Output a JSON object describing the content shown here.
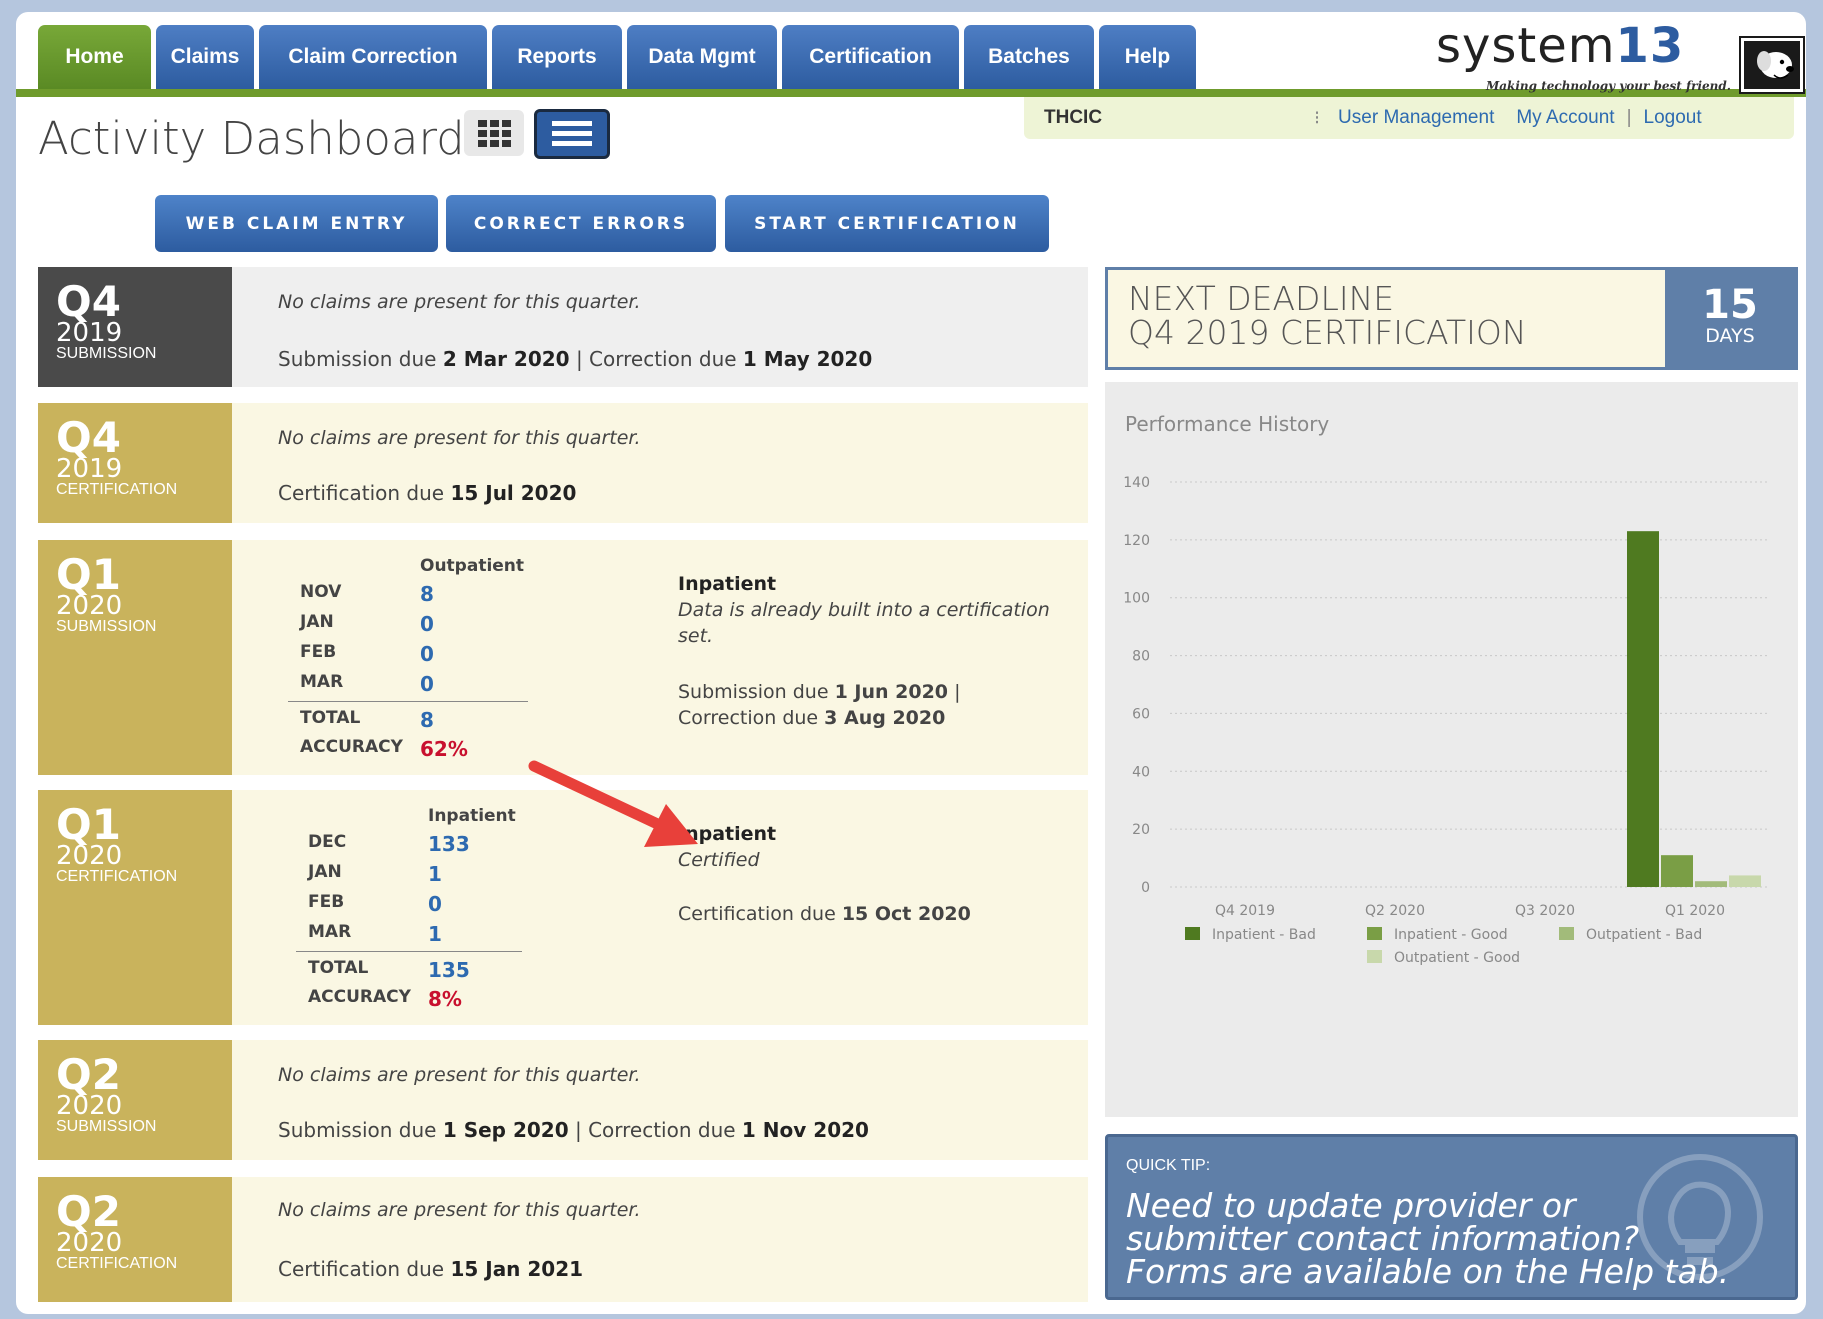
{
  "nav": {
    "tabs": [
      "Home",
      "Claims",
      "Claim Correction",
      "Reports",
      "Data Mgmt",
      "Certification",
      "Batches",
      "Help"
    ],
    "active_tab": "Home"
  },
  "logo": {
    "name_part1": "system",
    "name_part2": "13",
    "tagline": "Making technology your best friend."
  },
  "account": {
    "org": "THCIC",
    "links": {
      "user_management": "User Management",
      "my_account": "My Account",
      "logout": "Logout"
    }
  },
  "header": {
    "title": "Activity Dashboard"
  },
  "actions": {
    "web_claim_entry": "WEB CLAIM ENTRY",
    "correct_errors": "CORRECT ERRORS",
    "start_certification": "START CERTIFICATION"
  },
  "quarters": [
    {
      "q": "Q4",
      "year": "2019",
      "kind": "SUBMISSION",
      "note": "No claims are present for this quarter.",
      "due_parts": [
        "Submission due ",
        "2 Mar 2020",
        " | Correction due ",
        "1 May 2020"
      ]
    },
    {
      "q": "Q4",
      "year": "2019",
      "kind": "CERTIFICATION",
      "note": "No claims are present for this quarter.",
      "due_parts": [
        "Certification due ",
        "15 Jul 2020"
      ]
    },
    {
      "q": "Q1",
      "year": "2020",
      "kind": "SUBMISSION",
      "stats_header": "Outpatient",
      "rows": [
        {
          "label": "NOV",
          "value": "8"
        },
        {
          "label": "JAN",
          "value": "0"
        },
        {
          "label": "FEB",
          "value": "0"
        },
        {
          "label": "MAR",
          "value": "0"
        }
      ],
      "total_label": "TOTAL",
      "total": "8",
      "accuracy_label": "ACCURACY",
      "accuracy": "62%",
      "side_title": "Inpatient",
      "side_italic": "Data is already built into a certification set.",
      "side_due_parts": [
        "Submission due ",
        "1 Jun 2020",
        " |",
        "Correction due ",
        "3 Aug 2020"
      ]
    },
    {
      "q": "Q1",
      "year": "2020",
      "kind": "CERTIFICATION",
      "stats_header": "Inpatient",
      "rows": [
        {
          "label": "DEC",
          "value": "133"
        },
        {
          "label": "JAN",
          "value": "1"
        },
        {
          "label": "FEB",
          "value": "0"
        },
        {
          "label": "MAR",
          "value": "1"
        }
      ],
      "total_label": "TOTAL",
      "total": "135",
      "accuracy_label": "ACCURACY",
      "accuracy": "8%",
      "side_title": "Inpatient",
      "side_italic": "Certified",
      "side_due_parts": [
        "Certification due ",
        "15 Oct 2020"
      ]
    },
    {
      "q": "Q2",
      "year": "2020",
      "kind": "SUBMISSION",
      "note": "No claims are present for this quarter.",
      "due_parts": [
        "Submission due ",
        "1 Sep 2020",
        " | Correction due ",
        "1 Nov 2020"
      ]
    },
    {
      "q": "Q2",
      "year": "2020",
      "kind": "CERTIFICATION",
      "note": "No claims are present for this quarter.",
      "due_parts": [
        "Certification due ",
        "15 Jan 2021"
      ]
    }
  ],
  "deadline": {
    "line1": "NEXT DEADLINE",
    "line2": "Q4 2019 CERTIFICATION",
    "count": "15",
    "unit": "DAYS"
  },
  "tip": {
    "label": "QUICK TIP:",
    "text": "Need to update provider or submitter contact information? Forms are available on the Help tab."
  },
  "chart_data": {
    "type": "bar",
    "title": "Performance History",
    "categories": [
      "Q4 2019",
      "Q1 2020"
    ],
    "x_tick_labels": [
      "Q4 2019",
      "Q2 2020",
      "Q3 2020",
      "Q1 2020"
    ],
    "ylim": [
      0,
      140
    ],
    "yticks": [
      0,
      20,
      40,
      60,
      80,
      100,
      120,
      140
    ],
    "grid": true,
    "legend_position": "bottom",
    "series": [
      {
        "name": "Inpatient - Bad",
        "color": "#4f7a20",
        "values": [
          0,
          123
        ]
      },
      {
        "name": "Inpatient - Good",
        "color": "#7a9e45",
        "values": [
          0,
          11
        ]
      },
      {
        "name": "Outpatient - Bad",
        "color": "#a2bb7a",
        "values": [
          0,
          2
        ]
      },
      {
        "name": "Outpatient - Good",
        "color": "#c8d8ab",
        "values": [
          0,
          4
        ]
      }
    ]
  },
  "colors": {
    "nav_blue": "#2d5ca0",
    "nav_green": "#6f9b2c",
    "gold": "#c9b35c",
    "dark": "#4a4a4a",
    "red": "#c8102e",
    "slate": "#5f7fa8"
  }
}
